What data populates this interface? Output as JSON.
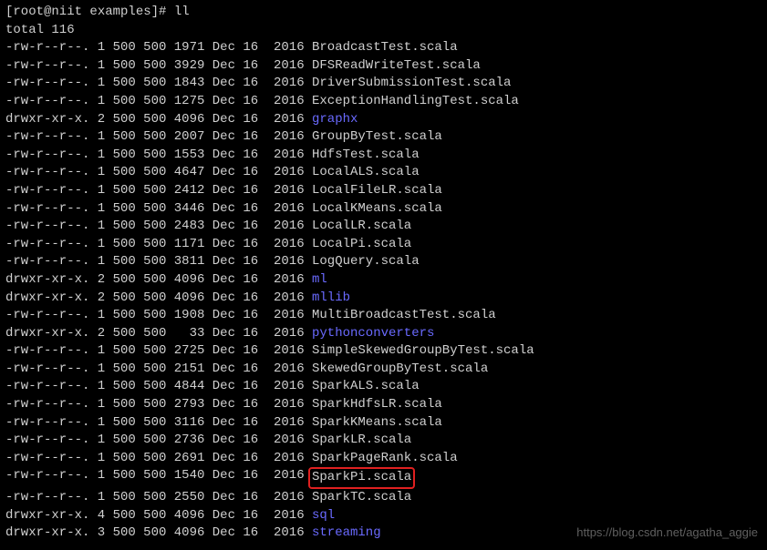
{
  "prompt": "[root@niit examples]# ll",
  "total_line": "total 116",
  "watermark": "https://blog.csdn.net/agatha_aggie",
  "files": [
    {
      "perms": "-rw-r--r--.",
      "links": "1",
      "owner": "500",
      "group": "500",
      "size": "1971",
      "month": "Dec",
      "day": "16",
      "year": "2016",
      "name": "BroadcastTest.scala",
      "dir": false,
      "hl": false
    },
    {
      "perms": "-rw-r--r--.",
      "links": "1",
      "owner": "500",
      "group": "500",
      "size": "3929",
      "month": "Dec",
      "day": "16",
      "year": "2016",
      "name": "DFSReadWriteTest.scala",
      "dir": false,
      "hl": false
    },
    {
      "perms": "-rw-r--r--.",
      "links": "1",
      "owner": "500",
      "group": "500",
      "size": "1843",
      "month": "Dec",
      "day": "16",
      "year": "2016",
      "name": "DriverSubmissionTest.scala",
      "dir": false,
      "hl": false
    },
    {
      "perms": "-rw-r--r--.",
      "links": "1",
      "owner": "500",
      "group": "500",
      "size": "1275",
      "month": "Dec",
      "day": "16",
      "year": "2016",
      "name": "ExceptionHandlingTest.scala",
      "dir": false,
      "hl": false
    },
    {
      "perms": "drwxr-xr-x.",
      "links": "2",
      "owner": "500",
      "group": "500",
      "size": "4096",
      "month": "Dec",
      "day": "16",
      "year": "2016",
      "name": "graphx",
      "dir": true,
      "hl": false
    },
    {
      "perms": "-rw-r--r--.",
      "links": "1",
      "owner": "500",
      "group": "500",
      "size": "2007",
      "month": "Dec",
      "day": "16",
      "year": "2016",
      "name": "GroupByTest.scala",
      "dir": false,
      "hl": false
    },
    {
      "perms": "-rw-r--r--.",
      "links": "1",
      "owner": "500",
      "group": "500",
      "size": "1553",
      "month": "Dec",
      "day": "16",
      "year": "2016",
      "name": "HdfsTest.scala",
      "dir": false,
      "hl": false
    },
    {
      "perms": "-rw-r--r--.",
      "links": "1",
      "owner": "500",
      "group": "500",
      "size": "4647",
      "month": "Dec",
      "day": "16",
      "year": "2016",
      "name": "LocalALS.scala",
      "dir": false,
      "hl": false
    },
    {
      "perms": "-rw-r--r--.",
      "links": "1",
      "owner": "500",
      "group": "500",
      "size": "2412",
      "month": "Dec",
      "day": "16",
      "year": "2016",
      "name": "LocalFileLR.scala",
      "dir": false,
      "hl": false
    },
    {
      "perms": "-rw-r--r--.",
      "links": "1",
      "owner": "500",
      "group": "500",
      "size": "3446",
      "month": "Dec",
      "day": "16",
      "year": "2016",
      "name": "LocalKMeans.scala",
      "dir": false,
      "hl": false
    },
    {
      "perms": "-rw-r--r--.",
      "links": "1",
      "owner": "500",
      "group": "500",
      "size": "2483",
      "month": "Dec",
      "day": "16",
      "year": "2016",
      "name": "LocalLR.scala",
      "dir": false,
      "hl": false
    },
    {
      "perms": "-rw-r--r--.",
      "links": "1",
      "owner": "500",
      "group": "500",
      "size": "1171",
      "month": "Dec",
      "day": "16",
      "year": "2016",
      "name": "LocalPi.scala",
      "dir": false,
      "hl": false
    },
    {
      "perms": "-rw-r--r--.",
      "links": "1",
      "owner": "500",
      "group": "500",
      "size": "3811",
      "month": "Dec",
      "day": "16",
      "year": "2016",
      "name": "LogQuery.scala",
      "dir": false,
      "hl": false
    },
    {
      "perms": "drwxr-xr-x.",
      "links": "2",
      "owner": "500",
      "group": "500",
      "size": "4096",
      "month": "Dec",
      "day": "16",
      "year": "2016",
      "name": "ml",
      "dir": true,
      "hl": false
    },
    {
      "perms": "drwxr-xr-x.",
      "links": "2",
      "owner": "500",
      "group": "500",
      "size": "4096",
      "month": "Dec",
      "day": "16",
      "year": "2016",
      "name": "mllib",
      "dir": true,
      "hl": false
    },
    {
      "perms": "-rw-r--r--.",
      "links": "1",
      "owner": "500",
      "group": "500",
      "size": "1908",
      "month": "Dec",
      "day": "16",
      "year": "2016",
      "name": "MultiBroadcastTest.scala",
      "dir": false,
      "hl": false
    },
    {
      "perms": "drwxr-xr-x.",
      "links": "2",
      "owner": "500",
      "group": "500",
      "size": "33",
      "month": "Dec",
      "day": "16",
      "year": "2016",
      "name": "pythonconverters",
      "dir": true,
      "hl": false
    },
    {
      "perms": "-rw-r--r--.",
      "links": "1",
      "owner": "500",
      "group": "500",
      "size": "2725",
      "month": "Dec",
      "day": "16",
      "year": "2016",
      "name": "SimpleSkewedGroupByTest.scala",
      "dir": false,
      "hl": false
    },
    {
      "perms": "-rw-r--r--.",
      "links": "1",
      "owner": "500",
      "group": "500",
      "size": "2151",
      "month": "Dec",
      "day": "16",
      "year": "2016",
      "name": "SkewedGroupByTest.scala",
      "dir": false,
      "hl": false
    },
    {
      "perms": "-rw-r--r--.",
      "links": "1",
      "owner": "500",
      "group": "500",
      "size": "4844",
      "month": "Dec",
      "day": "16",
      "year": "2016",
      "name": "SparkALS.scala",
      "dir": false,
      "hl": false
    },
    {
      "perms": "-rw-r--r--.",
      "links": "1",
      "owner": "500",
      "group": "500",
      "size": "2793",
      "month": "Dec",
      "day": "16",
      "year": "2016",
      "name": "SparkHdfsLR.scala",
      "dir": false,
      "hl": false
    },
    {
      "perms": "-rw-r--r--.",
      "links": "1",
      "owner": "500",
      "group": "500",
      "size": "3116",
      "month": "Dec",
      "day": "16",
      "year": "2016",
      "name": "SparkKMeans.scala",
      "dir": false,
      "hl": false
    },
    {
      "perms": "-rw-r--r--.",
      "links": "1",
      "owner": "500",
      "group": "500",
      "size": "2736",
      "month": "Dec",
      "day": "16",
      "year": "2016",
      "name": "SparkLR.scala",
      "dir": false,
      "hl": false
    },
    {
      "perms": "-rw-r--r--.",
      "links": "1",
      "owner": "500",
      "group": "500",
      "size": "2691",
      "month": "Dec",
      "day": "16",
      "year": "2016",
      "name": "SparkPageRank.scala",
      "dir": false,
      "hl": false
    },
    {
      "perms": "-rw-r--r--.",
      "links": "1",
      "owner": "500",
      "group": "500",
      "size": "1540",
      "month": "Dec",
      "day": "16",
      "year": "2016",
      "name": "SparkPi.scala",
      "dir": false,
      "hl": true
    },
    {
      "perms": "-rw-r--r--.",
      "links": "1",
      "owner": "500",
      "group": "500",
      "size": "2550",
      "month": "Dec",
      "day": "16",
      "year": "2016",
      "name": "SparkTC.scala",
      "dir": false,
      "hl": false
    },
    {
      "perms": "drwxr-xr-x.",
      "links": "4",
      "owner": "500",
      "group": "500",
      "size": "4096",
      "month": "Dec",
      "day": "16",
      "year": "2016",
      "name": "sql",
      "dir": true,
      "hl": false
    },
    {
      "perms": "drwxr-xr-x.",
      "links": "3",
      "owner": "500",
      "group": "500",
      "size": "4096",
      "month": "Dec",
      "day": "16",
      "year": "2016",
      "name": "streaming",
      "dir": true,
      "hl": false
    }
  ]
}
